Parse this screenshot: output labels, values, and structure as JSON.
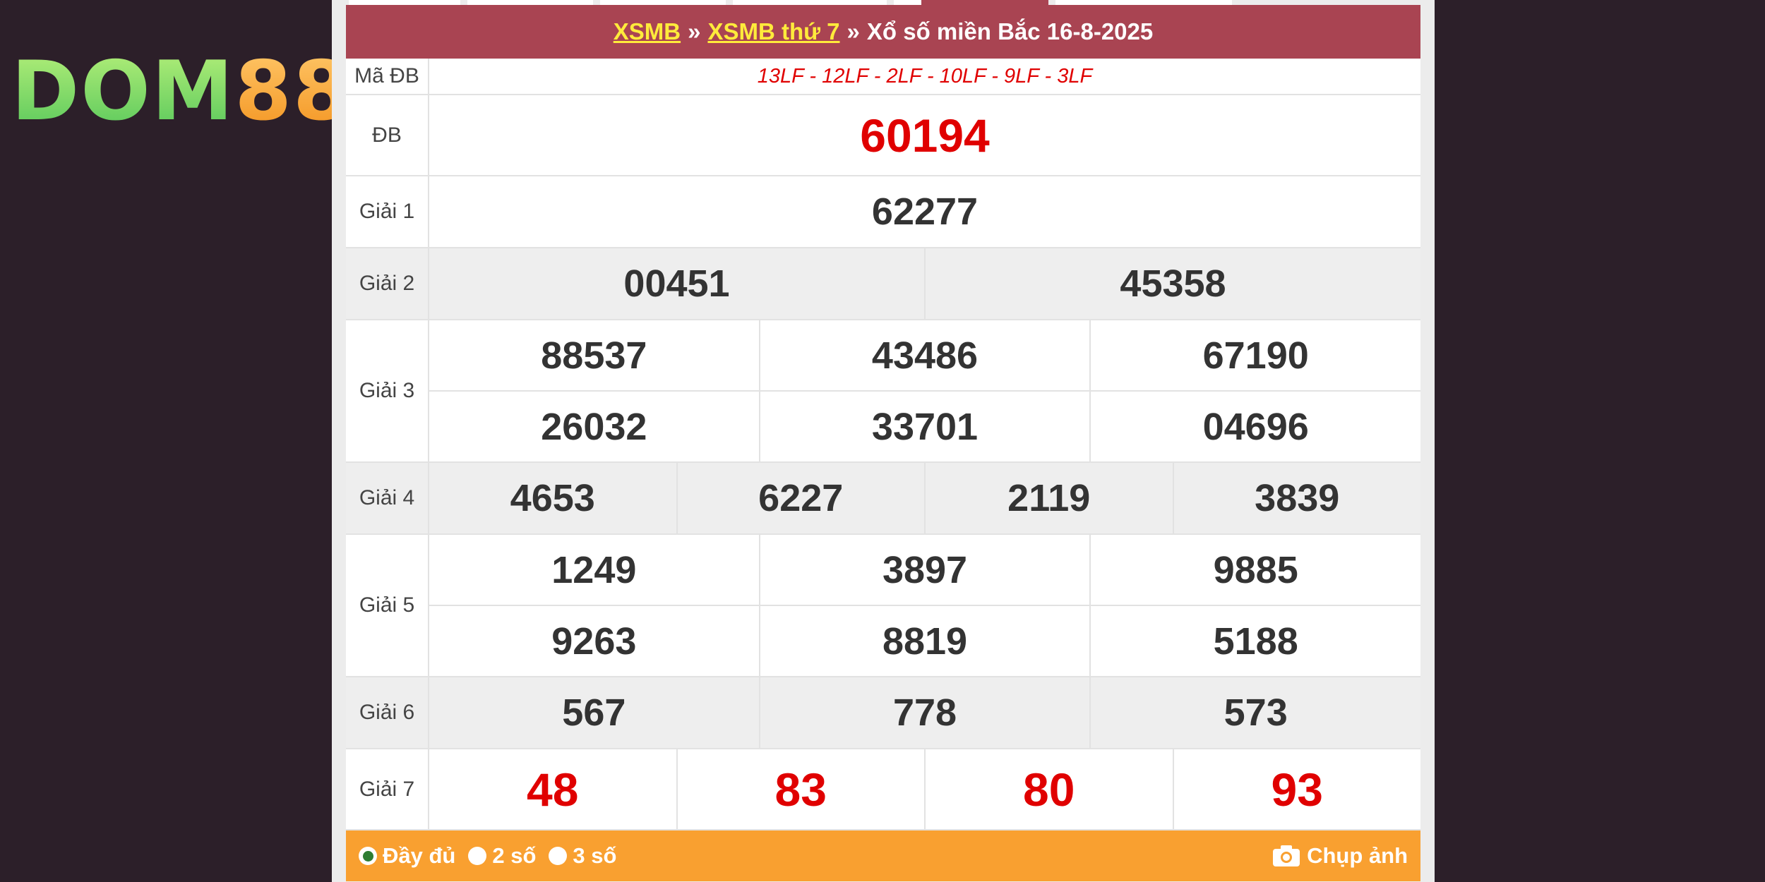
{
  "brand": {
    "logo_left": "DOM",
    "logo_right": "88"
  },
  "header": {
    "link1": "XSMB",
    "sep1": "»",
    "link2": "XSMB thứ 7",
    "sep2": "»",
    "title": "Xổ số miền Bắc 16-8-2025"
  },
  "results": {
    "code": {
      "label": "Mã ĐB",
      "value": "13LF - 12LF - 2LF - 10LF - 9LF - 3LF"
    },
    "db": {
      "label": "ĐB",
      "numbers": [
        "60194"
      ]
    },
    "g1": {
      "label": "Giải 1",
      "numbers": [
        "62277"
      ]
    },
    "g2": {
      "label": "Giải 2",
      "numbers": [
        "00451",
        "45358"
      ]
    },
    "g3": {
      "label": "Giải 3",
      "numbers": [
        "88537",
        "43486",
        "67190",
        "26032",
        "33701",
        "04696"
      ]
    },
    "g4": {
      "label": "Giải 4",
      "numbers": [
        "4653",
        "6227",
        "2119",
        "3839"
      ]
    },
    "g5": {
      "label": "Giải 5",
      "numbers": [
        "1249",
        "3897",
        "9885",
        "9263",
        "8819",
        "5188"
      ]
    },
    "g6": {
      "label": "Giải 6",
      "numbers": [
        "567",
        "778",
        "573"
      ]
    },
    "g7": {
      "label": "Giải 7",
      "numbers": [
        "48",
        "83",
        "80",
        "93"
      ]
    }
  },
  "footer": {
    "options": [
      {
        "label": "Đầy đủ",
        "selected": true
      },
      {
        "label": "2 số",
        "selected": false
      },
      {
        "label": "3 số",
        "selected": false
      }
    ],
    "capture_label": "Chụp ảnh",
    "capture_icon": "camera-icon"
  },
  "colors": {
    "header_bg": "#a94452",
    "link_yellow": "#ffeb3b",
    "number_red": "#e00000",
    "footer_bg": "#f9a030",
    "page_bg": "#2c1f29"
  }
}
